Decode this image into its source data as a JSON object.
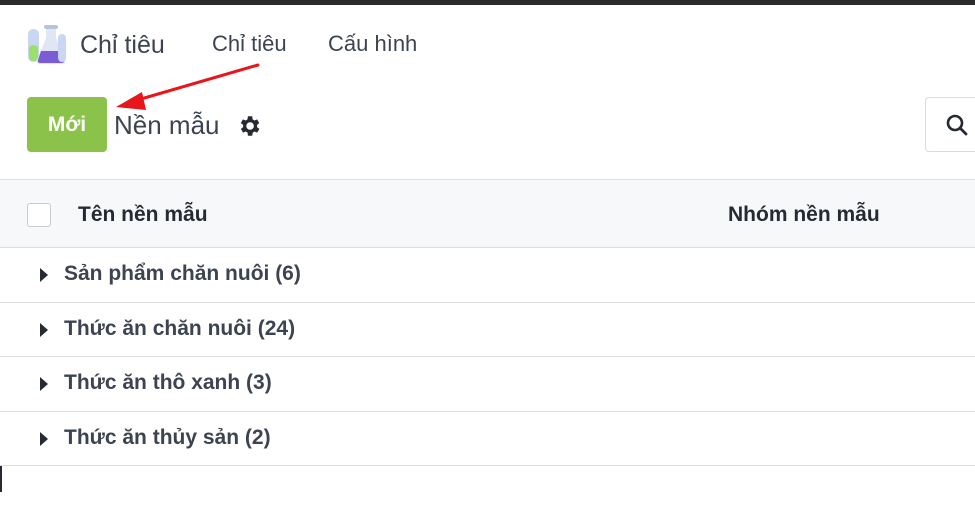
{
  "navbar": {
    "app_name": "Chỉ tiêu",
    "menu": [
      "Chỉ tiêu",
      "Cấu hình"
    ]
  },
  "control_panel": {
    "new_button": "Mới",
    "breadcrumb": "Nền mẫu"
  },
  "table": {
    "columns": [
      "Tên nền mẫu",
      "Nhóm nền mẫu"
    ],
    "groups": [
      {
        "label": "Sản phẩm chăn nuôi (6)"
      },
      {
        "label": "Thức ăn chăn nuôi (24)"
      },
      {
        "label": "Thức ăn thô xanh (3)"
      },
      {
        "label": "Thức ăn thủy sản (2)"
      }
    ]
  },
  "colors": {
    "accent": "#8bc34a",
    "annotation": "#e8161b"
  },
  "icons": [
    "app-flask-icon",
    "gear-icon",
    "search-icon",
    "caret-right-icon"
  ]
}
